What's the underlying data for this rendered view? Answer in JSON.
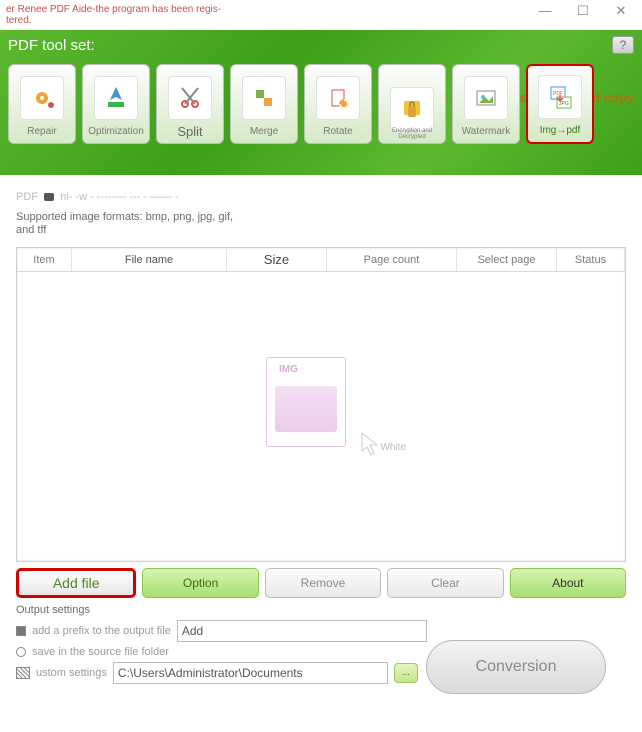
{
  "window": {
    "title": "er Renee PDF Aide-the program has been regis-\ntered."
  },
  "header": {
    "title": "PDF tool set:",
    "subtitle": "gy, the Text in the Image or scanned copy",
    "help": "?"
  },
  "tools": [
    {
      "label": "Repair",
      "icon": "gear"
    },
    {
      "label": "Optimization",
      "icon": "rocket"
    },
    {
      "label": "Split",
      "icon": "scissors"
    },
    {
      "label": "Merge",
      "icon": "puzzle"
    },
    {
      "label": "Rotate",
      "icon": "rotate"
    },
    {
      "label": "",
      "icon": "lock",
      "tiny": "Encryption and Decrypted"
    },
    {
      "label": "Watermark",
      "icon": "image"
    },
    {
      "label": "Img→pdf",
      "icon": "imgpdf",
      "selected": true
    }
  ],
  "screen_line_a": "PDF",
  "screen_line_b": "ni-                 -w - -------- --- -  —— -",
  "formats_text": "Supported image formats: bmp, png, jpg, gif, and tff",
  "columns": {
    "item": "Item",
    "fname": "File name",
    "size": "Size",
    "pcount": "Page count",
    "sel": "Select page",
    "stat": "Status"
  },
  "drop": {
    "img_tag": "IMG",
    "white": "White"
  },
  "buttons": {
    "add": "Add file",
    "option": "Option",
    "remove": "Remove",
    "clear": "Clear",
    "about": "About"
  },
  "output": {
    "title": "Output settings",
    "prefix_label": "add a prefix to the output file",
    "prefix_value": "Add",
    "save_src": "save in the source file folder",
    "custom": "ustom settings",
    "path": "C:\\Users\\Administrator\\Documents",
    "browse": "..."
  },
  "conversion": "Conversion"
}
